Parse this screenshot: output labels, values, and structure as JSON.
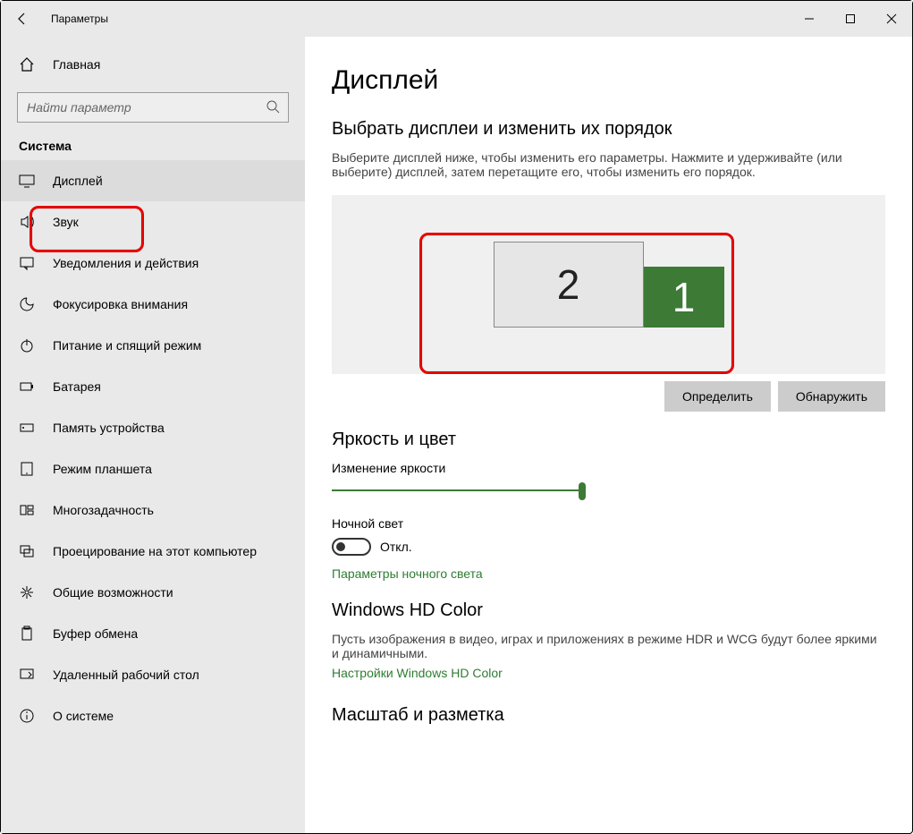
{
  "window": {
    "title": "Параметры"
  },
  "sidebar": {
    "home": "Главная",
    "search_placeholder": "Найти параметр",
    "group": "Система",
    "items": [
      {
        "label": "Дисплей"
      },
      {
        "label": "Звук"
      },
      {
        "label": "Уведомления и действия"
      },
      {
        "label": "Фокусировка внимания"
      },
      {
        "label": "Питание и спящий режим"
      },
      {
        "label": "Батарея"
      },
      {
        "label": "Память устройства"
      },
      {
        "label": "Режим планшета"
      },
      {
        "label": "Многозадачность"
      },
      {
        "label": "Проецирование на этот компьютер"
      },
      {
        "label": "Общие возможности"
      },
      {
        "label": "Буфер обмена"
      },
      {
        "label": "Удаленный рабочий стол"
      },
      {
        "label": "О системе"
      }
    ]
  },
  "main": {
    "heading": "Дисплей",
    "arrange": {
      "title": "Выбрать дисплеи и изменить их порядок",
      "desc": "Выберите дисплей ниже, чтобы изменить его параметры. Нажмите и удерживайте (или выберите) дисплей, затем перетащите его, чтобы изменить его порядок.",
      "monitor1": "1",
      "monitor2": "2",
      "identify": "Определить",
      "detect": "Обнаружить"
    },
    "brightness": {
      "title": "Яркость и цвет",
      "slider_label": "Изменение яркости",
      "night_label": "Ночной свет",
      "toggle_state": "Откл.",
      "night_link": "Параметры ночного света"
    },
    "hdcolor": {
      "title": "Windows HD Color",
      "desc": "Пусть изображения в видео, играх и приложениях в режиме HDR и WCG будут более яркими и динамичными.",
      "link": "Настройки Windows HD Color"
    },
    "scale_title": "Масштаб и разметка"
  }
}
